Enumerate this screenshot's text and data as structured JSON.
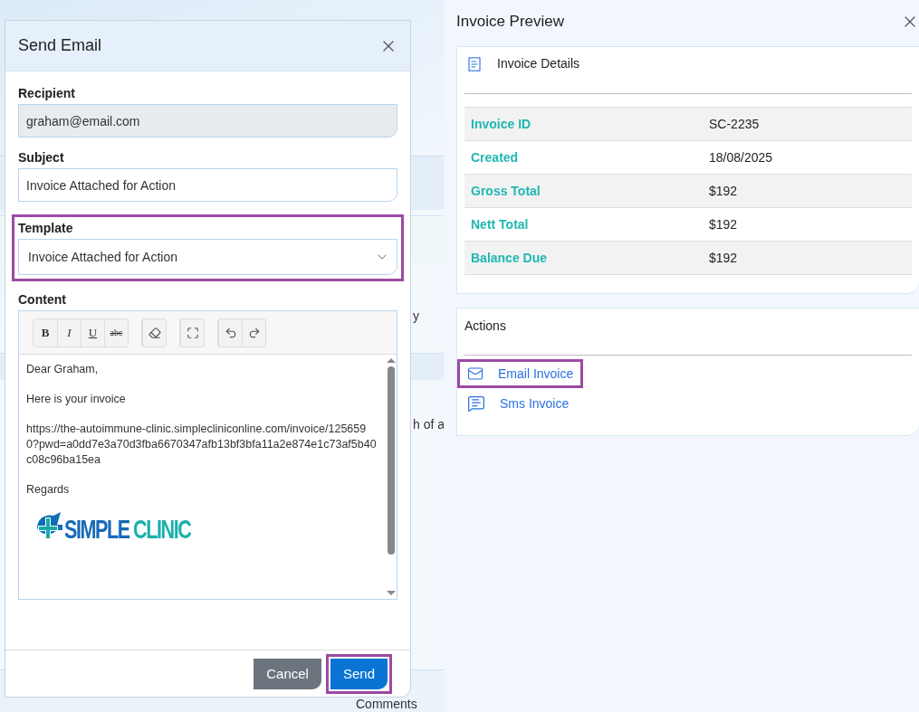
{
  "background": {
    "fragments": [
      "y",
      "h of a",
      "Comments"
    ]
  },
  "send_email": {
    "title": "Send Email",
    "recipient": {
      "label": "Recipient",
      "value": "graham@email.com",
      "disabled": true
    },
    "subject": {
      "label": "Subject",
      "value": "Invoice Attached for Action"
    },
    "template": {
      "label": "Template",
      "value": "Invoice Attached for Action",
      "highlighted": true
    },
    "content": {
      "label": "Content",
      "format_buttons": [
        "B",
        "I",
        "U",
        "abc"
      ],
      "paragraphs": [
        "Dear Graham,",
        "Here is your invoice",
        "https://the-autoimmune-clinic.simplecliniconline.com/invoice/1256590?pwd=a0dd7e3a70d3fba6670347afb13bf3bfa11a2e874e1c73af5b40c08c96ba15ea",
        "Regards"
      ],
      "logo": {
        "first": "SIMPLE",
        "second": "CLINIC"
      }
    },
    "buttons": [
      {
        "label": "Cancel",
        "kind": "secondary",
        "highlighted": false
      },
      {
        "label": "Send",
        "kind": "primary",
        "highlighted": true
      }
    ]
  },
  "invoice_preview": {
    "title": "Invoice Preview",
    "details": {
      "title": "Invoice Details",
      "rows": [
        {
          "label": "Invoice ID",
          "value": "SC-2235"
        },
        {
          "label": "Created",
          "value": "18/08/2025"
        },
        {
          "label": "Gross Total",
          "value": "$192"
        },
        {
          "label": "Nett Total",
          "value": "$192"
        },
        {
          "label": "Balance Due",
          "value": "$192"
        }
      ]
    },
    "actions": {
      "title": "Actions",
      "items": [
        {
          "label": "Email Invoice",
          "kind": "email",
          "highlighted": true
        },
        {
          "label": "Sms Invoice",
          "kind": "sms",
          "highlighted": false
        }
      ]
    }
  }
}
